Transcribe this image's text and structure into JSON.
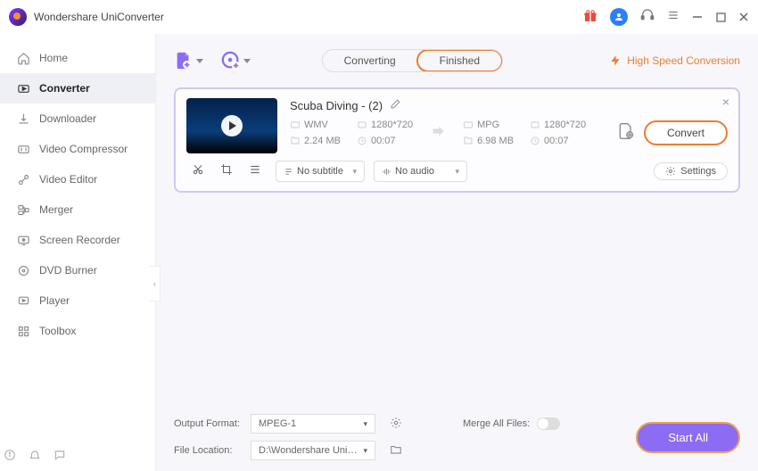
{
  "app_title": "Wondershare UniConverter",
  "titlebar": {
    "gift_icon": "gift-icon",
    "avatar_icon": "avatar",
    "headset_icon": "support",
    "menu_icon": "menu",
    "min": "minimize",
    "max": "maximize",
    "close": "close"
  },
  "sidebar": {
    "items": [
      {
        "icon": "home",
        "label": "Home"
      },
      {
        "icon": "converter",
        "label": "Converter"
      },
      {
        "icon": "downloader",
        "label": "Downloader"
      },
      {
        "icon": "compressor",
        "label": "Video Compressor"
      },
      {
        "icon": "editor",
        "label": "Video Editor"
      },
      {
        "icon": "merger",
        "label": "Merger"
      },
      {
        "icon": "recorder",
        "label": "Screen Recorder"
      },
      {
        "icon": "dvd",
        "label": "DVD Burner"
      },
      {
        "icon": "player",
        "label": "Player"
      },
      {
        "icon": "toolbox",
        "label": "Toolbox"
      }
    ],
    "active_index": 1
  },
  "toolbar": {
    "tabs": {
      "converting": "Converting",
      "finished": "Finished"
    },
    "high_speed": "High Speed Conversion"
  },
  "card": {
    "title": "Scuba Diving - (2)",
    "source": {
      "format": "WMV",
      "resolution": "1280*720",
      "size": "2.24 MB",
      "duration": "00:07"
    },
    "target": {
      "format": "MPG",
      "resolution": "1280*720",
      "size": "6.98 MB",
      "duration": "00:07"
    },
    "convert_label": "Convert",
    "subtitle_dd": "No subtitle",
    "audio_dd": "No audio",
    "settings_label": "Settings"
  },
  "bottom": {
    "output_label": "Output Format:",
    "output_value": "MPEG-1",
    "location_label": "File Location:",
    "location_value": "D:\\Wondershare UniConverter",
    "merge_label": "Merge All Files:",
    "start_all": "Start All"
  }
}
